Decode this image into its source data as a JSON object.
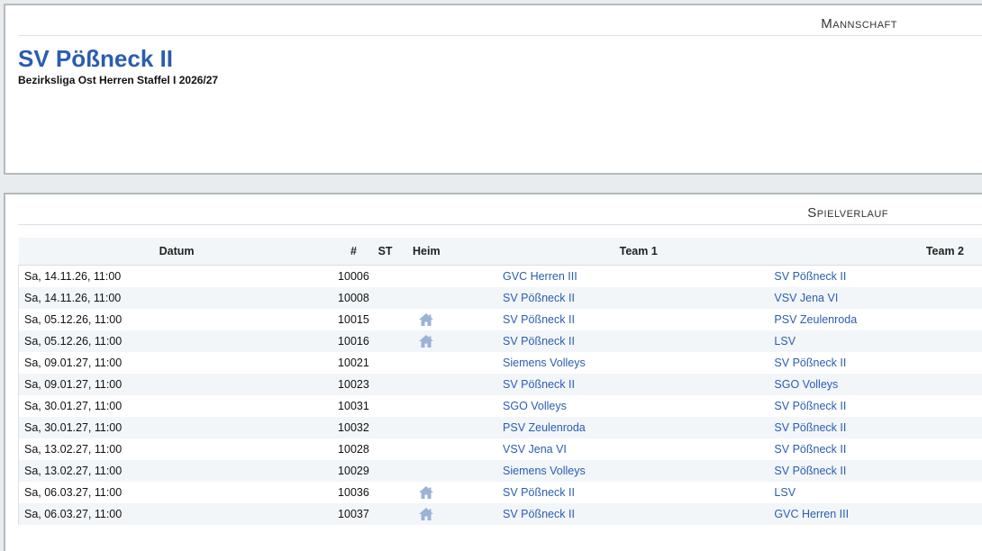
{
  "section_team": "Mannschaft",
  "team": {
    "name": "SV Pößneck II",
    "league": "Bezirksliga Ost Herren Staffel I 2026/27"
  },
  "section_games": "Spielverlauf",
  "colors": {
    "link": "#2a5db0",
    "home_icon": "#9bb3d6",
    "title": "#2a5db0"
  },
  "table": {
    "headers": {
      "datum": "Datum",
      "nr": "#",
      "st": "ST",
      "heim": "Heim",
      "team1": "Team 1",
      "team2": "Team 2"
    },
    "rows": [
      {
        "datum": "Sa, 14.11.26, 11:00",
        "nr": "10006",
        "home": false,
        "team1": "GVC Herren III",
        "team2": "SV Pößneck II"
      },
      {
        "datum": "Sa, 14.11.26, 11:00",
        "nr": "10008",
        "home": false,
        "team1": "SV Pößneck II",
        "team2": "VSV Jena VI"
      },
      {
        "datum": "Sa, 05.12.26, 11:00",
        "nr": "10015",
        "home": true,
        "team1": "SV Pößneck II",
        "team2": "PSV Zeulenroda"
      },
      {
        "datum": "Sa, 05.12.26, 11:00",
        "nr": "10016",
        "home": true,
        "team1": "SV Pößneck II",
        "team2": "LSV"
      },
      {
        "datum": "Sa, 09.01.27, 11:00",
        "nr": "10021",
        "home": false,
        "team1": "Siemens Volleys",
        "team2": "SV Pößneck II"
      },
      {
        "datum": "Sa, 09.01.27, 11:00",
        "nr": "10023",
        "home": false,
        "team1": "SV Pößneck II",
        "team2": "SGO Volleys"
      },
      {
        "datum": "Sa, 30.01.27, 11:00",
        "nr": "10031",
        "home": false,
        "team1": "SGO Volleys",
        "team2": "SV Pößneck II"
      },
      {
        "datum": "Sa, 30.01.27, 11:00",
        "nr": "10032",
        "home": false,
        "team1": "PSV Zeulenroda",
        "team2": "SV Pößneck II"
      },
      {
        "datum": "Sa, 13.02.27, 11:00",
        "nr": "10028",
        "home": false,
        "team1": "VSV Jena VI",
        "team2": "SV Pößneck II"
      },
      {
        "datum": "Sa, 13.02.27, 11:00",
        "nr": "10029",
        "home": false,
        "team1": "Siemens Volleys",
        "team2": "SV Pößneck II"
      },
      {
        "datum": "Sa, 06.03.27, 11:00",
        "nr": "10036",
        "home": true,
        "team1": "SV Pößneck II",
        "team2": "LSV"
      },
      {
        "datum": "Sa, 06.03.27, 11:00",
        "nr": "10037",
        "home": true,
        "team1": "SV Pößneck II",
        "team2": "GVC Herren III"
      }
    ]
  }
}
